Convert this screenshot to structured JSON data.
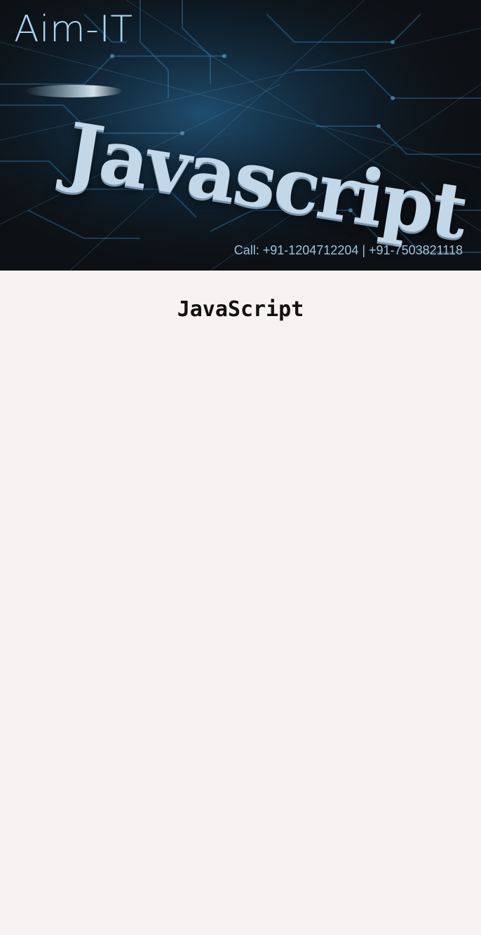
{
  "banner": {
    "brand": "Aim-IT",
    "hero_word": "Javascript",
    "contact": "Call: +91-1204712204 | +91-7503821118"
  },
  "main": {
    "heading": "JavaScript"
  },
  "colors": {
    "page_background": "#f8f3f2",
    "banner_background": "#0d1115",
    "circuit_glow": "#2f7fb8",
    "brand_text": "#a9d6ef",
    "contact_text": "#9fc3de"
  }
}
